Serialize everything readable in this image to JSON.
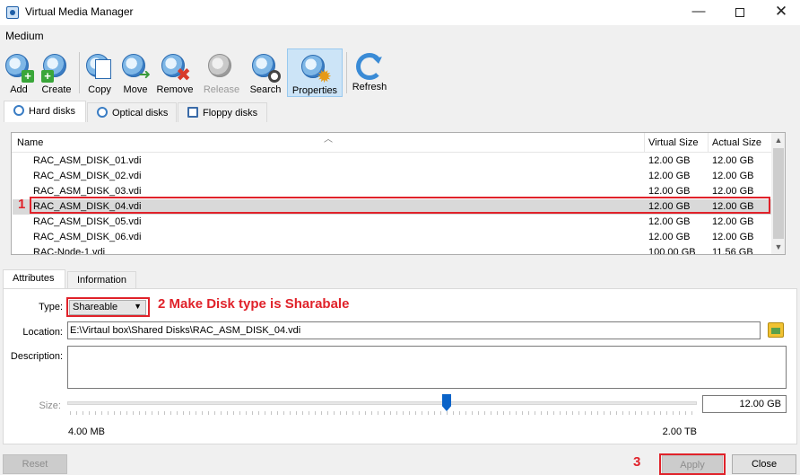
{
  "window": {
    "title": "Virtual Media Manager",
    "min_glyph": "—",
    "close_glyph": "✕"
  },
  "menu": {
    "items": [
      "Medium"
    ]
  },
  "toolbar": {
    "buttons": [
      {
        "label": "Add",
        "icon": "add-disk-icon",
        "enabled": true
      },
      {
        "label": "Create",
        "icon": "create-disk-icon",
        "enabled": true
      },
      {
        "label": "Copy",
        "icon": "copy-disk-icon",
        "enabled": true
      },
      {
        "label": "Move",
        "icon": "move-disk-icon",
        "enabled": true
      },
      {
        "label": "Remove",
        "icon": "remove-disk-icon",
        "enabled": true
      },
      {
        "label": "Release",
        "icon": "release-disk-icon",
        "enabled": false
      },
      {
        "label": "Search",
        "icon": "search-disk-icon",
        "enabled": true
      },
      {
        "label": "Properties",
        "icon": "properties-icon",
        "enabled": true,
        "active": true
      },
      {
        "label": "Refresh",
        "icon": "refresh-icon",
        "enabled": true
      }
    ]
  },
  "tabs": [
    {
      "label": "Hard disks",
      "active": true
    },
    {
      "label": "Optical disks",
      "active": false
    },
    {
      "label": "Floppy disks",
      "active": false
    }
  ],
  "table": {
    "columns": [
      "Name",
      "Virtual Size",
      "Actual Size"
    ],
    "rows": [
      {
        "name": "RAC_ASM_DISK_01.vdi",
        "virtual": "12.00 GB",
        "actual": "12.00 GB"
      },
      {
        "name": "RAC_ASM_DISK_02.vdi",
        "virtual": "12.00 GB",
        "actual": "12.00 GB"
      },
      {
        "name": "RAC_ASM_DISK_03.vdi",
        "virtual": "12.00 GB",
        "actual": "12.00 GB"
      },
      {
        "name": "RAC_ASM_DISK_04.vdi",
        "virtual": "12.00 GB",
        "actual": "12.00 GB",
        "selected": true
      },
      {
        "name": "RAC_ASM_DISK_05.vdi",
        "virtual": "12.00 GB",
        "actual": "12.00 GB"
      },
      {
        "name": "RAC_ASM_DISK_06.vdi",
        "virtual": "12.00 GB",
        "actual": "12.00 GB"
      },
      {
        "name": "RAC-Node-1.vdi",
        "virtual": "100.00 GB",
        "actual": "11.56 GB"
      }
    ],
    "scroll_up": "▲",
    "scroll_down": "▼"
  },
  "detail_tabs": [
    {
      "label": "Attributes",
      "active": true
    },
    {
      "label": "Information",
      "active": false
    }
  ],
  "attributes": {
    "type_label": "Type:",
    "type_value": "Shareable",
    "location_label": "Location:",
    "location_value": "E:\\Virtaul box\\Shared Disks\\RAC_ASM_DISK_04.vdi",
    "description_label": "Description:",
    "size_label": "Size:",
    "size_value": "12.00 GB",
    "size_min": "4.00 MB",
    "size_max": "2.00 TB",
    "size_slider_fraction": 0.6
  },
  "buttons": {
    "reset": "Reset",
    "apply": "Apply",
    "close": "Close"
  },
  "annotations": {
    "step1": "1",
    "step2": "2 Make Disk type is Sharabale",
    "step3": "3",
    "color": "#e0222a"
  }
}
